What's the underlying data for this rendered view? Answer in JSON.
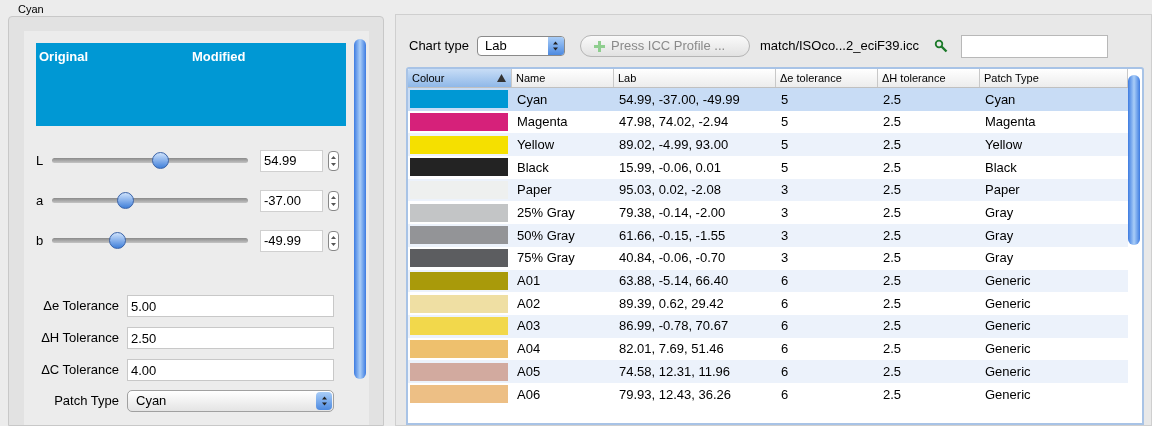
{
  "group_title": "Cyan",
  "preview": {
    "color": "#0098d4",
    "labels": [
      "Original",
      "Modified"
    ]
  },
  "sliders": [
    {
      "label": "L",
      "level": 0.55,
      "value": "54.99"
    },
    {
      "label": "a",
      "level": 0.37,
      "value": "-37.00"
    },
    {
      "label": "b",
      "level": 0.33,
      "value": "-49.99"
    }
  ],
  "tolerances": [
    {
      "label": "Δe Tolerance",
      "value": "5.00"
    },
    {
      "label": "ΔH Tolerance",
      "value": "2.50"
    },
    {
      "label": "ΔC Tolerance",
      "value": "4.00"
    }
  ],
  "patch_type": {
    "label": "Patch Type",
    "value": "Cyan"
  },
  "toolbar": {
    "chart_type_label": "Chart type",
    "chart_type": "Lab",
    "press_button": {
      "label": "Press ICC Profile ...",
      "disabled": true
    },
    "profile": "match/ISOco...2_eciF39.icc"
  },
  "table": {
    "columns": [
      {
        "label": "Colour",
        "sorted": true
      },
      {
        "label": "Name",
        "sorted": false
      },
      {
        "label": "Lab",
        "sorted": false
      },
      {
        "label": "Δe tolerance",
        "sorted": false
      },
      {
        "label": "ΔH tolerance",
        "sorted": false
      },
      {
        "label": "Patch Type",
        "sorted": false
      }
    ],
    "rows": [
      {
        "color": "#0098d4",
        "name": "Cyan",
        "lab": "54.99, -37.00, -49.99",
        "de": "5",
        "dh": "2.5",
        "type": "Cyan",
        "selected": true
      },
      {
        "color": "#d6217a",
        "name": "Magenta",
        "lab": "47.98, 74.02, -2.94",
        "de": "5",
        "dh": "2.5",
        "type": "Magenta",
        "selected": false
      },
      {
        "color": "#f5e000",
        "name": "Yellow",
        "lab": "89.02, -4.99, 93.00",
        "de": "5",
        "dh": "2.5",
        "type": "Yellow",
        "selected": false
      },
      {
        "color": "#232323",
        "name": "Black",
        "lab": "15.99, -0.06, 0.01",
        "de": "5",
        "dh": "2.5",
        "type": "Black",
        "selected": false
      },
      {
        "color": "#eef0ef",
        "name": "Paper",
        "lab": "95.03, 0.02, -2.08",
        "de": "3",
        "dh": "2.5",
        "type": "Paper",
        "selected": false
      },
      {
        "color": "#c3c5c6",
        "name": "25% Gray",
        "lab": "79.38, -0.14, -2.00",
        "de": "3",
        "dh": "2.5",
        "type": "Gray",
        "selected": false
      },
      {
        "color": "#939497",
        "name": "50% Gray",
        "lab": "61.66, -0.15, -1.55",
        "de": "3",
        "dh": "2.5",
        "type": "Gray",
        "selected": false
      },
      {
        "color": "#5c5d60",
        "name": "75% Gray",
        "lab": "40.84, -0.06, -0.70",
        "de": "3",
        "dh": "2.5",
        "type": "Gray",
        "selected": false
      },
      {
        "color": "#a99a0a",
        "name": "A01",
        "lab": "63.88, -5.14, 66.40",
        "de": "6",
        "dh": "2.5",
        "type": "Generic",
        "selected": false
      },
      {
        "color": "#efdfa3",
        "name": "A02",
        "lab": "89.39, 0.62, 29.42",
        "de": "6",
        "dh": "2.5",
        "type": "Generic",
        "selected": false
      },
      {
        "color": "#f2d84b",
        "name": "A03",
        "lab": "86.99, -0.78, 70.67",
        "de": "6",
        "dh": "2.5",
        "type": "Generic",
        "selected": false
      },
      {
        "color": "#eec06d",
        "name": "A04",
        "lab": "82.01, 7.69, 51.46",
        "de": "6",
        "dh": "2.5",
        "type": "Generic",
        "selected": false
      },
      {
        "color": "#d2aa9f",
        "name": "A05",
        "lab": "74.58, 12.31, 11.96",
        "de": "6",
        "dh": "2.5",
        "type": "Generic",
        "selected": false
      },
      {
        "color": "#edbf85",
        "name": "A06",
        "lab": "79.93, 12.43, 36.26",
        "de": "6",
        "dh": "2.5",
        "type": "Generic",
        "selected": false
      }
    ]
  }
}
